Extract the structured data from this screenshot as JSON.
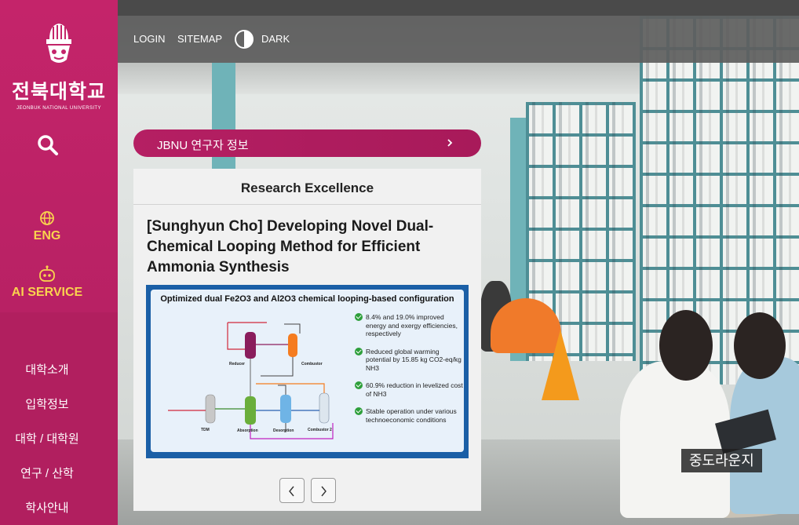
{
  "sidebar": {
    "logo": {
      "name_ko": "전북대학교",
      "name_en": "JEONBUK NATIONAL UNIVERSITY"
    },
    "quick": [
      {
        "label": "ENG",
        "icon": "globe-icon"
      },
      {
        "label": "AI SERVICE",
        "icon": "robot-icon"
      }
    ],
    "menu": [
      "대학소개",
      "입학정보",
      "대학 / 대학원",
      "연구 / 산학",
      "학사안내"
    ]
  },
  "topbar": {
    "login": "LOGIN",
    "sitemap": "SITEMAP",
    "dark": "DARK"
  },
  "research": {
    "pill_label": "JBNU 연구자 정보",
    "section_title": "Research Excellence",
    "headline": "[Sunghyun Cho] Developing Novel Dual-Chemical Looping Method for Efficient Ammonia Synthesis",
    "figure": {
      "title": "Optimized dual Fe2O3 and Al2O3 chemical looping-based configuration",
      "units": [
        "Reducer",
        "Combustor",
        "TDM",
        "Absorption",
        "Desorption",
        "Combustor 2"
      ],
      "bullets": [
        "8.4% and 19.0% improved energy and exergy efficiencies, respectively",
        "Reduced global warming potential by 15.85 kg CO2-eq/kg NH3",
        "60.9% reduction in levelized cost of NH3",
        "Stable operation under various technoeconomic conditions"
      ]
    }
  },
  "caption": "중도라운지",
  "colors": {
    "brand": "#b51f63",
    "accent": "#f9d34e"
  }
}
